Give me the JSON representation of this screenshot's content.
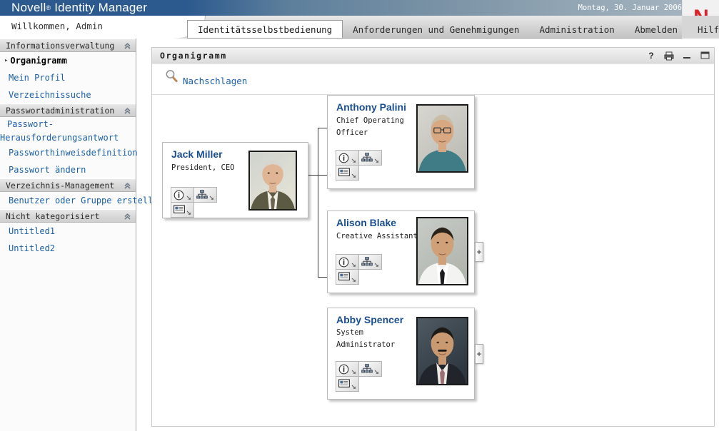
{
  "brand": {
    "product_prefix": "Novell",
    "registered_mark": "®",
    "product_name": "Identity Manager",
    "date": "Montag, 30. Januar 2006",
    "logo_letter": "N",
    "logo_color": "#e01f26",
    "bar_color": "#2c5a8e"
  },
  "welcome": {
    "text": "Willkommen, Admin"
  },
  "nav": {
    "tabs": [
      {
        "label": "Identitätsselbstbedienung",
        "active": true
      },
      {
        "label": "Anforderungen und Genehmigungen",
        "active": false
      },
      {
        "label": "Administration",
        "active": false
      },
      {
        "label": "Abmelden",
        "active": false
      },
      {
        "label": "Hilfe",
        "active": false
      }
    ]
  },
  "sidebar": {
    "groups": [
      {
        "label": "Informationsverwaltung",
        "collapse_icon": "chevron-up-double-icon",
        "items": [
          {
            "label": "Organigramm",
            "current": true
          },
          {
            "label": "Mein Profil",
            "current": false
          },
          {
            "label": "Verzeichnissuche",
            "current": false
          }
        ]
      },
      {
        "label": "Passwortadministration",
        "collapse_icon": "chevron-up-double-icon",
        "items": [
          {
            "label": "Passwort-",
            "label2": "Herausforderungsantwort",
            "current": false,
            "wrap": true
          },
          {
            "label": "Passworthinweisdefinition",
            "current": false
          },
          {
            "label": "Passwort ändern",
            "current": false
          }
        ]
      },
      {
        "label": "Verzeichnis-Management",
        "collapse_icon": "chevron-up-double-icon",
        "items": [
          {
            "label": "Benutzer oder Gruppe erstellen",
            "current": false
          }
        ]
      },
      {
        "label": "Nicht kategorisiert",
        "collapse_icon": "chevron-up-double-icon",
        "items": [
          {
            "label": "Untitled1",
            "current": false
          },
          {
            "label": "Untitled2",
            "current": false
          }
        ]
      }
    ]
  },
  "panel": {
    "title": "Organigramm",
    "controls": [
      {
        "name": "help-icon",
        "glyph": "?"
      },
      {
        "name": "print-icon",
        "glyph": "print"
      },
      {
        "name": "minimize-icon",
        "glyph": "minimize"
      },
      {
        "name": "maximize-icon",
        "glyph": "maximize"
      }
    ],
    "toolbar": {
      "lookup_icon": "magnifier-icon",
      "lookup_label": "Nachschlagen"
    }
  },
  "orgchart": {
    "root": {
      "name": "Jack Miller",
      "title": "President, CEO",
      "photo": "portrait-elderly-man-suit",
      "buttons": [
        {
          "name": "info-icon",
          "label": "Identitätsaktionen"
        },
        {
          "name": "org-chart-icon",
          "label": "Organigramm-Aktionen"
        },
        {
          "name": "email-card-icon",
          "label": "E-Mail-Aktionen"
        }
      ],
      "expand": null
    },
    "children": [
      {
        "name": "Anthony Palini",
        "title": "Chief Operating Officer",
        "title_lines": [
          "Chief Operating",
          "Officer"
        ],
        "photo": "portrait-man-glasses-teal-turtleneck",
        "buttons": [
          {
            "name": "info-icon",
            "label": "Identitätsaktionen"
          },
          {
            "name": "org-chart-icon",
            "label": "Organigramm-Aktionen"
          },
          {
            "name": "email-card-icon",
            "label": "E-Mail-Aktionen"
          }
        ],
        "expand": null
      },
      {
        "name": "Alison Blake",
        "title": "Creative Assistant",
        "title_lines": [
          "Creative Assistant"
        ],
        "photo": "portrait-man-dark-hair-white-shirt-tie",
        "buttons": [
          {
            "name": "info-icon",
            "label": "Identitätsaktionen"
          },
          {
            "name": "org-chart-icon",
            "label": "Organigramm-Aktionen"
          },
          {
            "name": "email-card-icon",
            "label": "E-Mail-Aktionen"
          }
        ],
        "expand": "+"
      },
      {
        "name": "Abby Spencer",
        "title": "System Administrator",
        "title_lines": [
          "System",
          "Administrator"
        ],
        "photo": "portrait-man-mustache-dark-suit",
        "buttons": [
          {
            "name": "info-icon",
            "label": "Identitätsaktionen"
          },
          {
            "name": "org-chart-icon",
            "label": "Organigramm-Aktionen"
          },
          {
            "name": "email-card-icon",
            "label": "E-Mail-Aktionen"
          }
        ],
        "expand": "+"
      }
    ]
  },
  "colors": {
    "accent_link": "#1b5fa8",
    "card_name": "#1a4f8f",
    "header_blue": "#2c5a8e",
    "logo_red": "#e01f26"
  }
}
